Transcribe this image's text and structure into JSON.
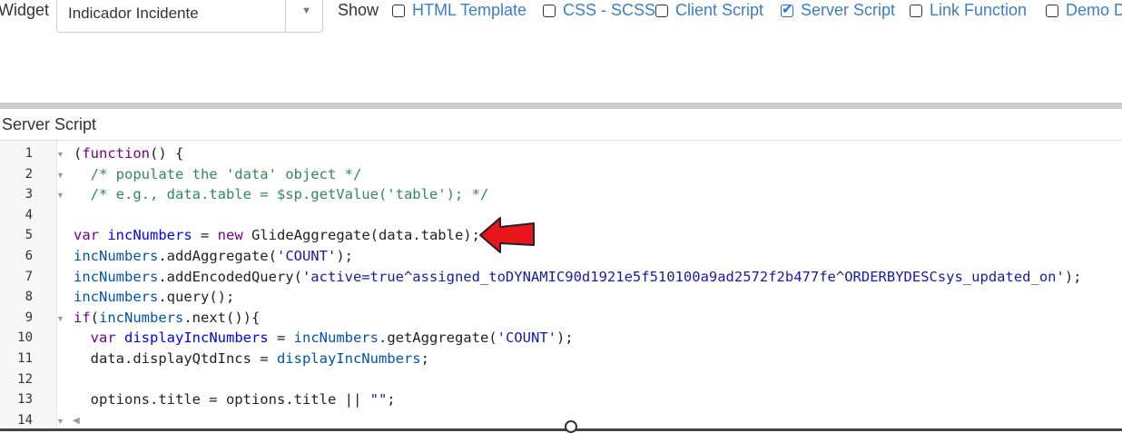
{
  "widget": {
    "label": "Widget",
    "selected": "Indicador Incidente",
    "arrow_icon": "triangle-down"
  },
  "show": {
    "label": "Show",
    "options": [
      {
        "label": "HTML Template",
        "checked": false
      },
      {
        "label": "CSS - SCSS",
        "checked": false
      },
      {
        "label": "Client Script",
        "checked": false
      },
      {
        "label": "Server Script",
        "checked": true
      },
      {
        "label": "Link Function",
        "checked": false
      },
      {
        "label": "Demo D",
        "checked": false
      }
    ]
  },
  "section": {
    "title": "Server Script"
  },
  "editor": {
    "lines": [
      {
        "n": "1",
        "fold": true,
        "tokens": [
          [
            "(",
            "plain"
          ],
          [
            "function",
            "kw"
          ],
          [
            "() {",
            "plain"
          ]
        ]
      },
      {
        "n": "2",
        "fold": true,
        "tokens": [
          [
            "  /* populate the 'data' object */",
            "com"
          ]
        ]
      },
      {
        "n": "3",
        "fold": true,
        "tokens": [
          [
            "  /* e.g., data.table = $sp.getValue('table'); */",
            "com"
          ]
        ]
      },
      {
        "n": "4",
        "fold": false,
        "tokens": []
      },
      {
        "n": "5",
        "fold": false,
        "tokens": [
          [
            "var",
            "kw"
          ],
          [
            " ",
            "plain"
          ],
          [
            "incNumbers",
            "def"
          ],
          [
            " = ",
            "plain"
          ],
          [
            "new",
            "kw"
          ],
          [
            " GlideAggregate(data.table);",
            "plain"
          ]
        ]
      },
      {
        "n": "6",
        "fold": false,
        "tokens": [
          [
            "incNumbers",
            "var"
          ],
          [
            ".addAggregate(",
            "plain"
          ],
          [
            "'COUNT'",
            "str"
          ],
          [
            ");",
            "plain"
          ]
        ]
      },
      {
        "n": "7",
        "fold": false,
        "tokens": [
          [
            "incNumbers",
            "var"
          ],
          [
            ".addEncodedQuery(",
            "plain"
          ],
          [
            "'active=true^assigned_toDYNAMIC90d1921e5f510100a9ad2572f2b477fe^ORDERBYDESCsys_updated_on'",
            "str"
          ],
          [
            ");",
            "plain"
          ]
        ]
      },
      {
        "n": "8",
        "fold": false,
        "tokens": [
          [
            "incNumbers",
            "var"
          ],
          [
            ".query();",
            "plain"
          ]
        ]
      },
      {
        "n": "9",
        "fold": true,
        "tokens": [
          [
            "if",
            "kw"
          ],
          [
            "(",
            "plain"
          ],
          [
            "incNumbers",
            "var"
          ],
          [
            ".next()){",
            "plain"
          ]
        ]
      },
      {
        "n": "10",
        "fold": false,
        "tokens": [
          [
            "  ",
            "plain"
          ],
          [
            "var",
            "kw"
          ],
          [
            " ",
            "plain"
          ],
          [
            "displayIncNumbers",
            "def"
          ],
          [
            " = ",
            "plain"
          ],
          [
            "incNumbers",
            "var"
          ],
          [
            ".getAggregate(",
            "plain"
          ],
          [
            "'COUNT'",
            "str"
          ],
          [
            ");",
            "plain"
          ]
        ]
      },
      {
        "n": "11",
        "fold": false,
        "tokens": [
          [
            "  data.displayQtdIncs = ",
            "plain"
          ],
          [
            "displayIncNumbers",
            "var"
          ],
          [
            ";",
            "plain"
          ]
        ]
      },
      {
        "n": "12",
        "fold": false,
        "tokens": []
      },
      {
        "n": "13",
        "fold": false,
        "tokens": [
          [
            "  options.title = options.title || ",
            "plain"
          ],
          [
            "\"\"",
            "str"
          ],
          [
            ";",
            "plain"
          ]
        ]
      },
      {
        "n": "14",
        "fold": true,
        "tokens": []
      }
    ]
  },
  "colors": {
    "link": "#3a7fc1",
    "arrow": "#e8151b"
  }
}
